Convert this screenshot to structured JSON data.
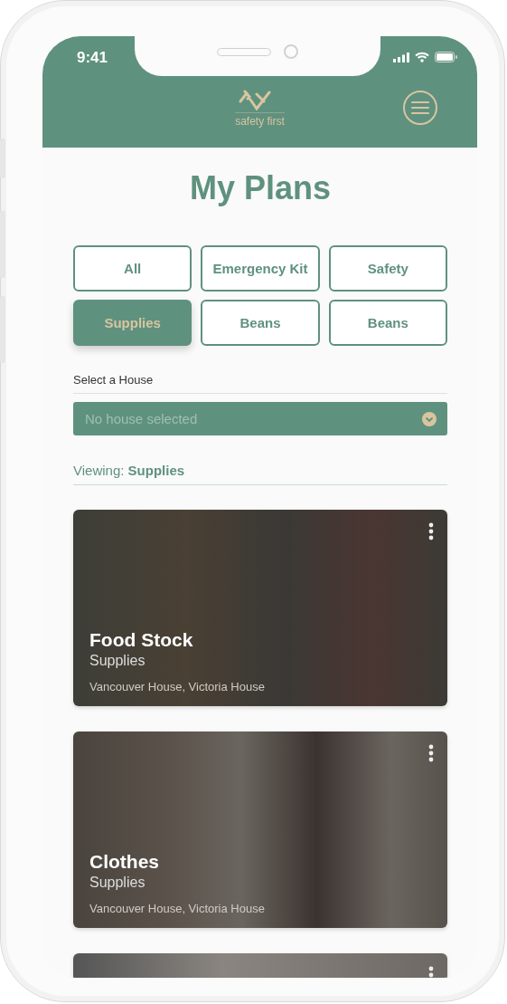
{
  "status_bar": {
    "time": "9:41"
  },
  "header": {
    "logo_text": "safety first"
  },
  "title": "My Plans",
  "filters": [
    {
      "label": "All",
      "selected": false
    },
    {
      "label": "Emergency Kit",
      "selected": false
    },
    {
      "label": "Safety",
      "selected": false
    },
    {
      "label": "Supplies",
      "selected": true
    },
    {
      "label": "Beans",
      "selected": false
    },
    {
      "label": "Beans",
      "selected": false
    }
  ],
  "house_select": {
    "label": "Select a House",
    "placeholder": "No house selected"
  },
  "viewing": "Viewing: **Supplies**",
  "cards": [
    {
      "title": "Food Stock",
      "category": "Supplies",
      "houses": "Vancouver House, Victoria House",
      "kind": "jars"
    },
    {
      "title": "Clothes",
      "category": "Supplies",
      "houses": "Vancouver House, Victoria House",
      "kind": "clothes"
    }
  ],
  "more_cards_below": true
}
